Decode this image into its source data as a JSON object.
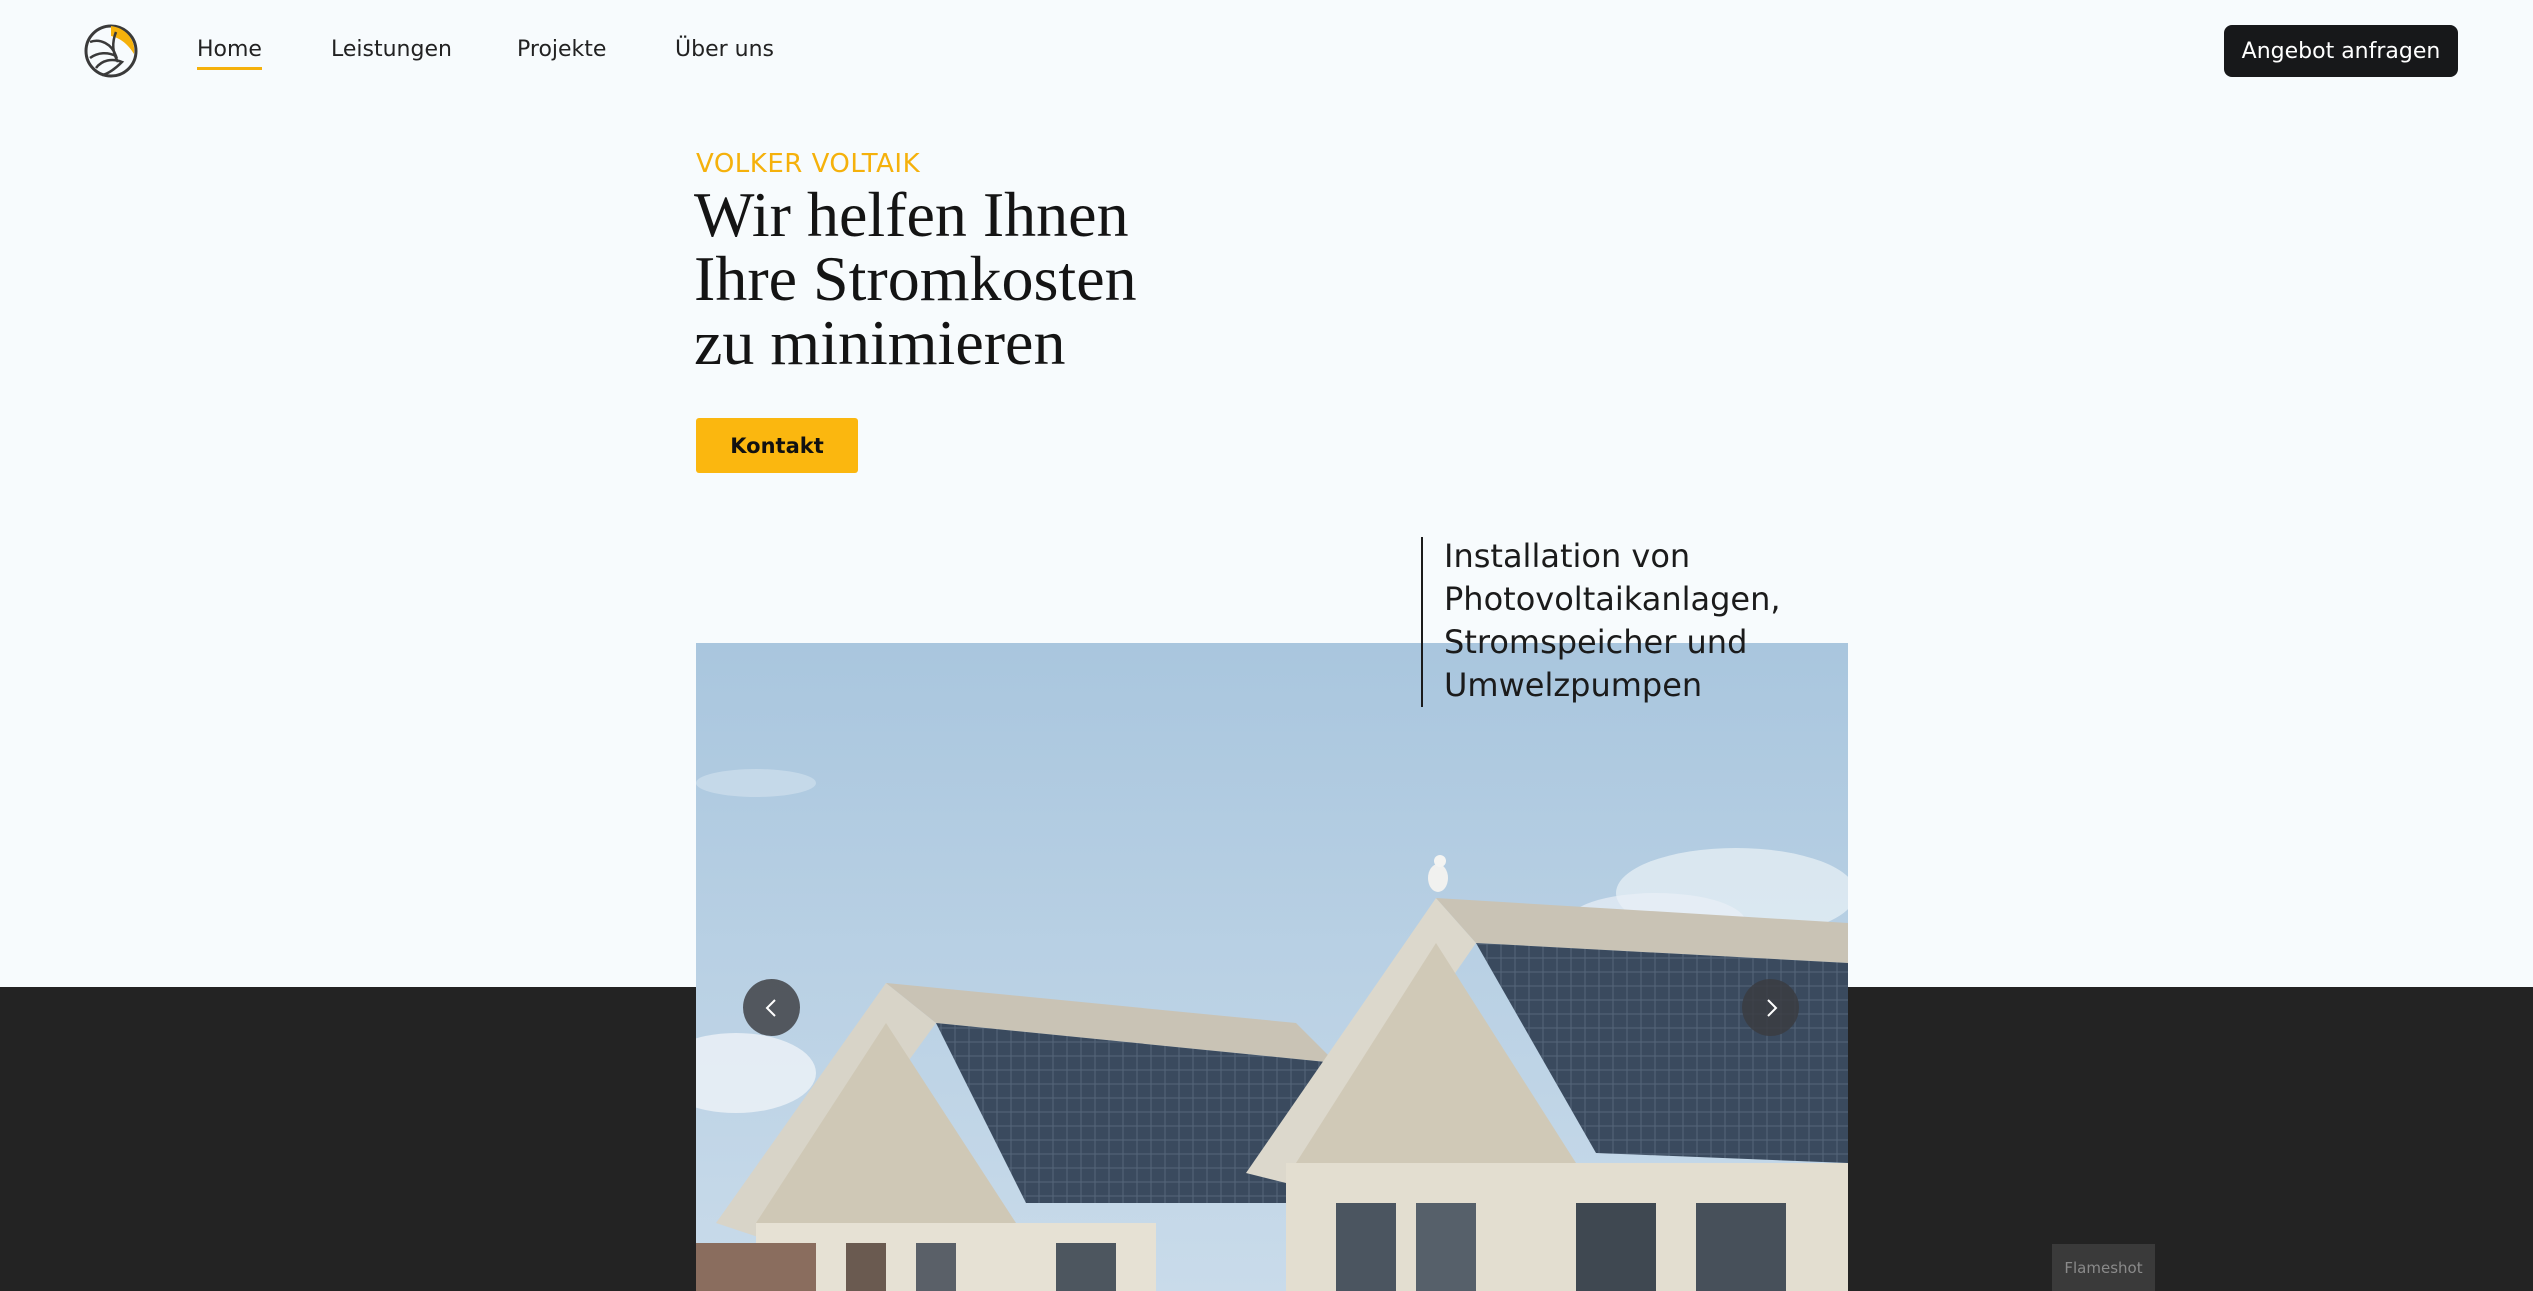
{
  "header": {
    "logo_icon": "solar-swirl-logo",
    "nav": [
      {
        "label": "Home",
        "active": true
      },
      {
        "label": "Leistungen",
        "active": false
      },
      {
        "label": "Projekte",
        "active": false
      },
      {
        "label": "Über uns",
        "active": false
      }
    ],
    "cta_label": "Angebot anfragen"
  },
  "hero": {
    "eyebrow": "VOLKER VOLTAIK",
    "headline_lines": [
      "Wir helfen Ihnen",
      "Ihre Stromkosten",
      "zu minimieren"
    ],
    "button_label": "Kontakt"
  },
  "services": {
    "lines": [
      "Installation von",
      "Photovoltaikanlagen,",
      "Stromspeicher und",
      "Umwelzpumpen"
    ]
  },
  "slider": {
    "image": "beach-huts-with-solar-roofs",
    "prev_icon": "chevron-left-icon",
    "next_icon": "chevron-right-icon"
  },
  "watermark": "Flameshot",
  "colors": {
    "accent": "#f5b10b",
    "background": "#f7fbfd",
    "dark": "#232323",
    "header_button": "#17181a"
  }
}
